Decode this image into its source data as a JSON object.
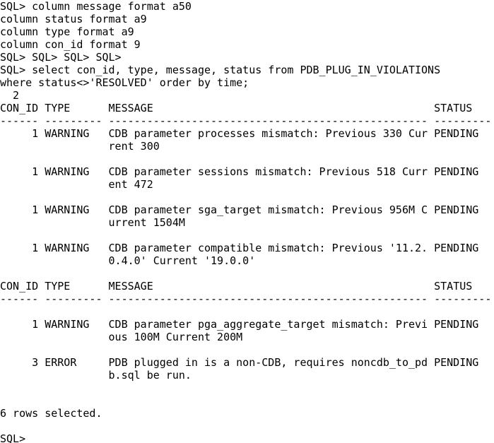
{
  "terminal": {
    "lines": [
      "SQL> column message format a50",
      "column status format a9",
      "column type format a9",
      "column con_id format 9",
      "SQL> SQL> SQL> SQL>",
      "SQL> select con_id, type, message, status from PDB_PLUG_IN_VIOLATIONS",
      "where status<>'RESOLVED' order by time;",
      "  2",
      "CON_ID TYPE      MESSAGE                                            STATUS",
      "------ --------- -------------------------------------------------- ---------",
      "     1 WARNING   CDB parameter processes mismatch: Previous 330 Cur PENDING",
      "                 rent 300",
      "",
      "     1 WARNING   CDB parameter sessions mismatch: Previous 518 Curr PENDING",
      "                 ent 472",
      "",
      "     1 WARNING   CDB parameter sga_target mismatch: Previous 956M C PENDING",
      "                 urrent 1504M",
      "",
      "     1 WARNING   CDB parameter compatible mismatch: Previous '11.2. PENDING",
      "                 0.4.0' Current '19.0.0'",
      "",
      "CON_ID TYPE      MESSAGE                                            STATUS",
      "------ --------- -------------------------------------------------- ---------",
      "",
      "     1 WARNING   CDB parameter pga_aggregate_target mismatch: Previ PENDING",
      "                 ous 100M Current 200M",
      "",
      "     3 ERROR     PDB plugged in is a non-CDB, requires noncdb_to_pd PENDING",
      "                 b.sql be run.",
      "",
      "",
      "6 rows selected.",
      "",
      "SQL>"
    ]
  }
}
